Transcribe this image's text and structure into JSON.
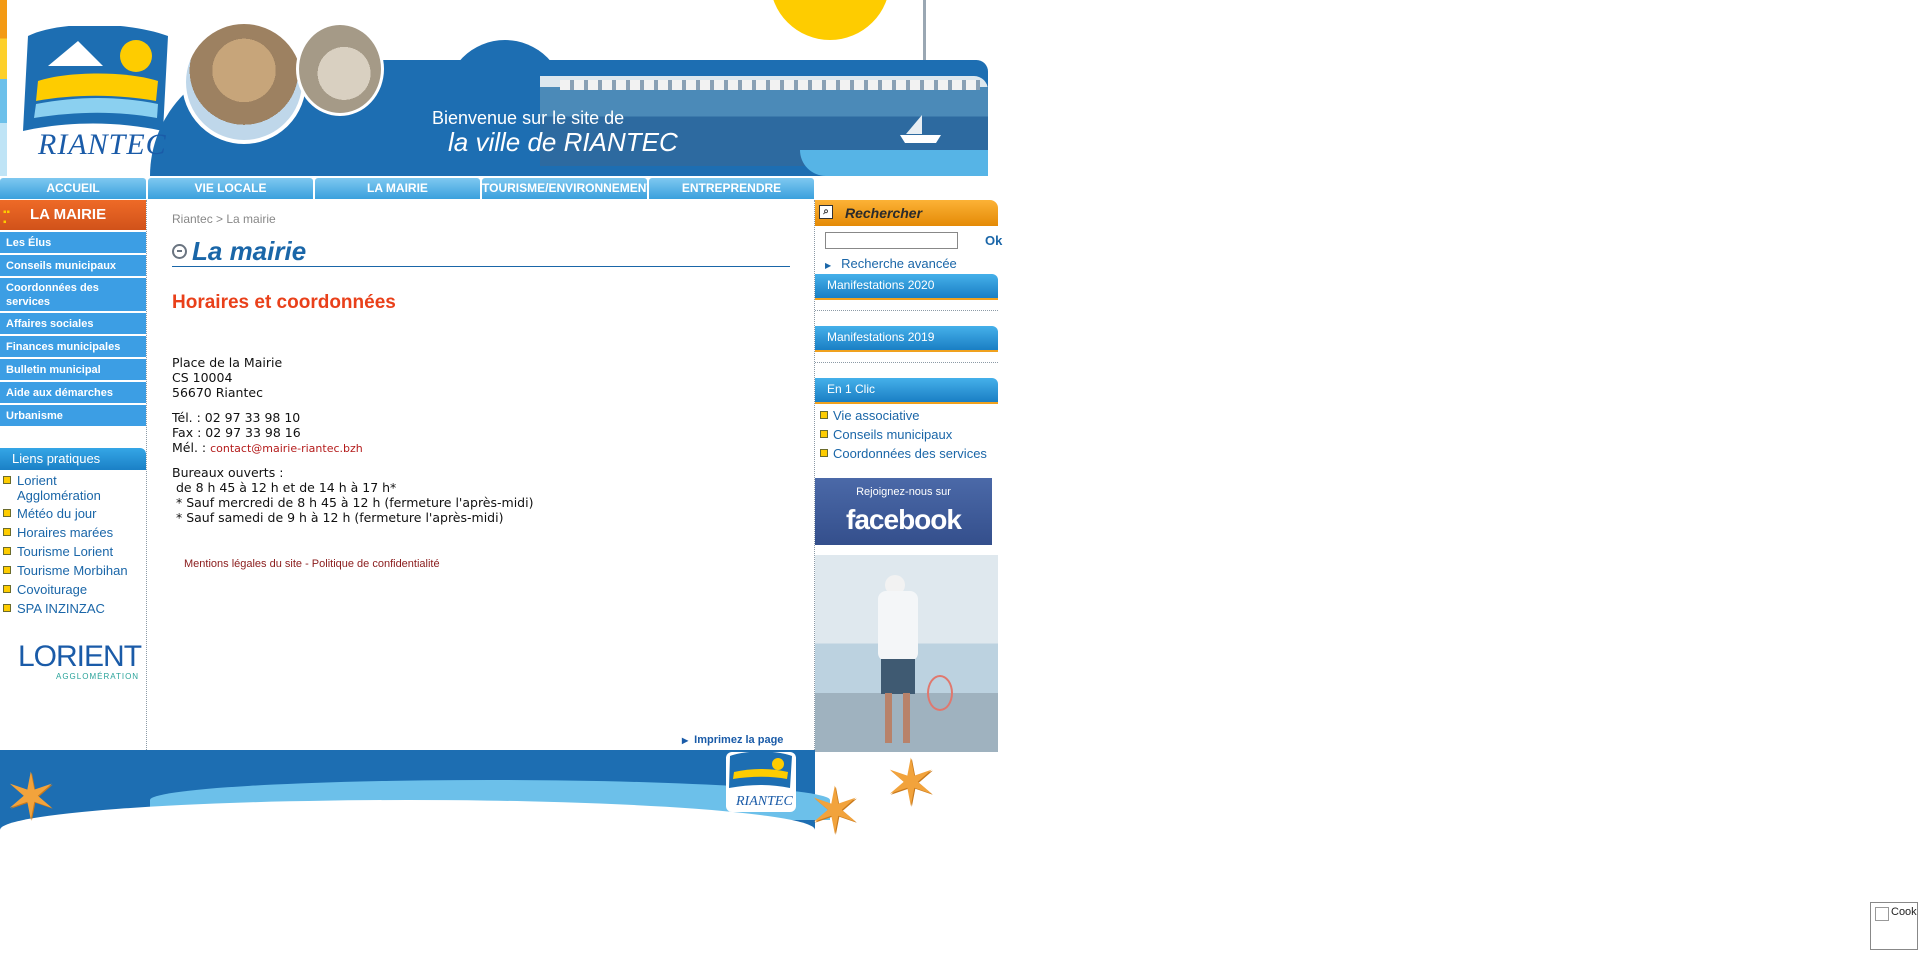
{
  "header": {
    "logo_text": "RIANTEC",
    "welcome_line1": "Bienvenue sur le site de",
    "welcome_line2": "la ville de RIANTEC"
  },
  "topnav": [
    {
      "label": "ACCUEIL"
    },
    {
      "label": "VIE LOCALE"
    },
    {
      "label": "LA MAIRIE"
    },
    {
      "label": "TOURISME/ENVIRONNEMENT"
    },
    {
      "label": "ENTREPRENDRE"
    }
  ],
  "leftmenu": {
    "title": "LA MAIRIE",
    "items": [
      {
        "label": "Les Élus"
      },
      {
        "label": "Conseils municipaux"
      },
      {
        "label": "Coordonnées des services"
      },
      {
        "label": "Affaires sociales"
      },
      {
        "label": "Finances municipales"
      },
      {
        "label": "Bulletin municipal"
      },
      {
        "label": "Aide aux démarches"
      },
      {
        "label": "Urbanisme"
      }
    ]
  },
  "liens": {
    "title": "Liens pratiques",
    "items": [
      {
        "label": "Lorient Agglomération"
      },
      {
        "label": "Météo du jour"
      },
      {
        "label": "Horaires marées"
      },
      {
        "label": "Tourisme Lorient"
      },
      {
        "label": "Tourisme Morbihan"
      },
      {
        "label": "Covoiturage"
      },
      {
        "label": "SPA INZINZAC"
      }
    ],
    "partner_logo_big": "LORIENT",
    "partner_logo_small": "AGGLOMÉRATION"
  },
  "main": {
    "breadcrumb": "Riantec > La mairie",
    "page_title": "La mairie",
    "section_heading": "Horaires et coordonnées",
    "address": [
      "Place de la Mairie",
      "CS 10004",
      "56670 Riantec"
    ],
    "tel": "Tél. : 02 97 33 98 10",
    "fax": "Fax : 02 97 33 98 16",
    "mail_label": "Mél. :",
    "mail": "contact@mairie-riantec.bzh",
    "hours": [
      "Bureaux ouverts :",
      " de 8 h 45 à 12 h et de 14 h à 17 h*",
      " * Sauf mercredi de 8 h 45 à 12 h (fermeture l'après-midi)",
      " * Sauf samedi de 9 h à 12 h (fermeture l'après-midi)"
    ],
    "mentions": "Mentions légales du site - Politique de confidentialité",
    "print": "Imprimez la page"
  },
  "right": {
    "search_title": "Rechercher",
    "search_placeholder": "",
    "search_ok": "Ok",
    "advanced_search": "Recherche avancée",
    "tab1": "Manifestations 2020",
    "tab2": "Manifestations 2019",
    "tab3": "En 1 Clic",
    "clic_items": [
      {
        "label": "Vie associative"
      },
      {
        "label": "Conseils municipaux"
      },
      {
        "label": "Coordonnées des services"
      }
    ],
    "facebook_join": "Rejoignez-nous sur",
    "facebook_name": "facebook"
  },
  "footer": {
    "logo_text": "RIANTEC"
  },
  "cookie": {
    "label": "Cook"
  },
  "colors": {
    "brand_blue": "#1a66a8",
    "accent_orange": "#e9401a",
    "menu_blue": "#3c9ee4",
    "sun_yellow": "#fecc00"
  }
}
